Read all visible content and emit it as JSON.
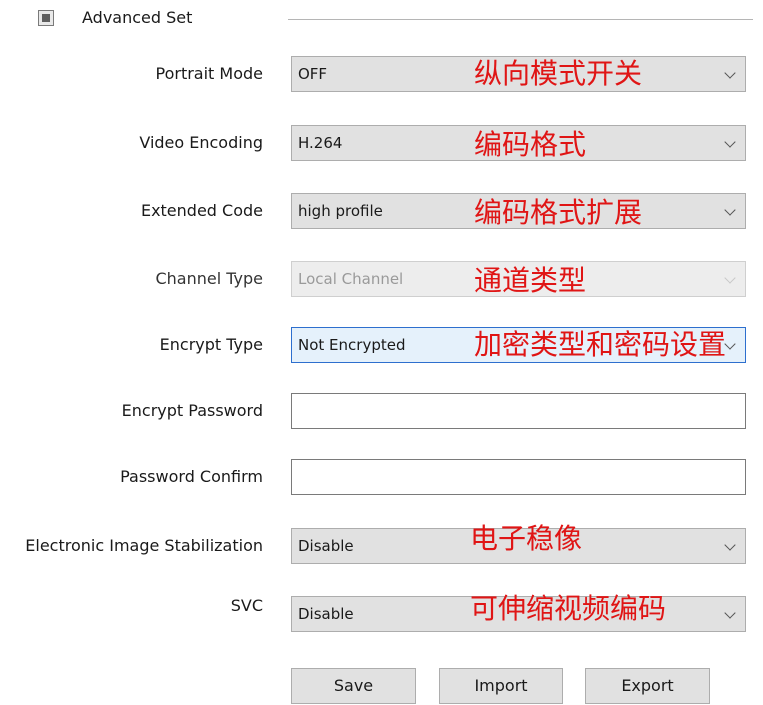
{
  "section": {
    "title": "Advanced Set",
    "icon": "collapse-toggle-icon"
  },
  "fields": [
    {
      "label": "Portrait Mode",
      "value": "OFF",
      "annotation": "纵向模式开关"
    },
    {
      "label": "Video Encoding",
      "value": "H.264",
      "annotation": "编码格式"
    },
    {
      "label": "Extended Code",
      "value": "high profile",
      "annotation": "编码格式扩展"
    },
    {
      "label": "Channel Type",
      "value": "Local Channel",
      "annotation": "通道类型",
      "disabled": true
    },
    {
      "label": "Encrypt Type",
      "value": "Not Encrypted",
      "annotation": "加密类型和密码设置",
      "focused": true
    },
    {
      "label": "Encrypt Password",
      "value": ""
    },
    {
      "label": "Password Confirm",
      "value": ""
    },
    {
      "label": "Electronic Image Stabilization",
      "value": "Disable",
      "annotation": "电子稳像"
    },
    {
      "label": "SVC",
      "value": "Disable",
      "annotation": "可伸缩视频编码"
    }
  ],
  "buttons": {
    "save": "Save",
    "import": "Import",
    "export": "Export"
  },
  "colors": {
    "annotation": "#e01515",
    "focus_border": "#2d6fce"
  }
}
